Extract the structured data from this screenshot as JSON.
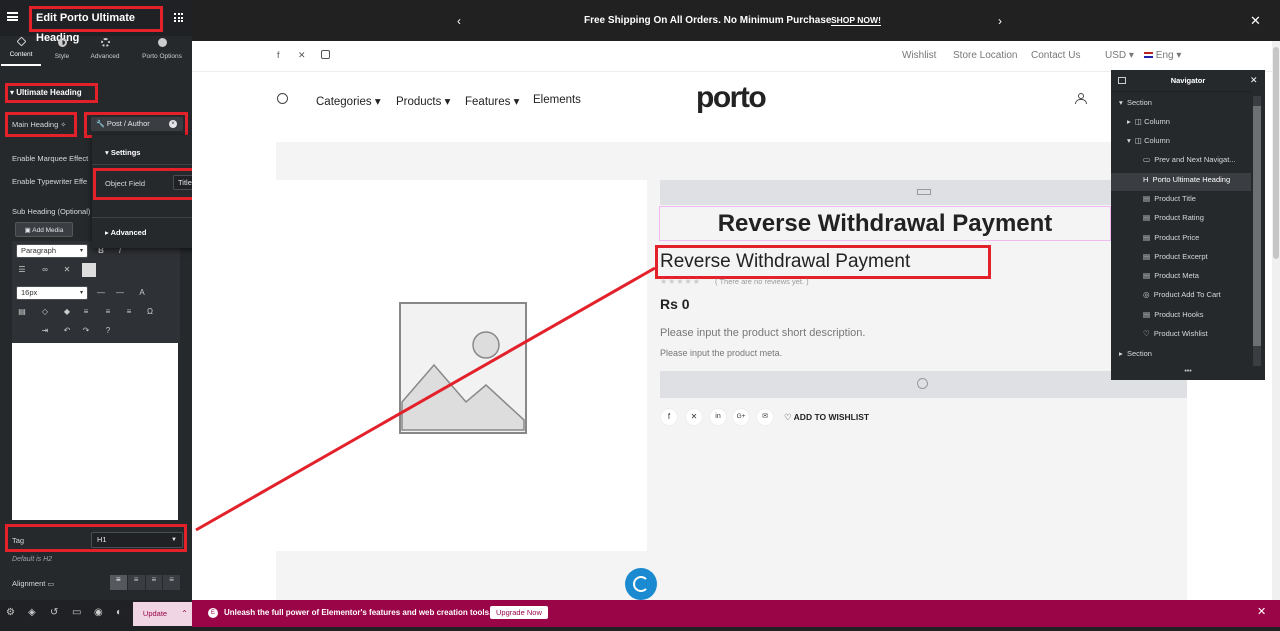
{
  "editor": {
    "title": "Edit Porto Ultimate Heading",
    "tabs": [
      {
        "label": "Content",
        "icon": "pencil-icon"
      },
      {
        "label": "Style",
        "icon": "contrast-icon"
      },
      {
        "label": "Advanced",
        "icon": "gear-icon"
      },
      {
        "label": "Porto Options",
        "icon": "porto-icon"
      }
    ],
    "section_title": "Ultimate Heading",
    "main_heading_label": "Main Heading",
    "dynamic_tag_chip": "Post / Author",
    "enable_marquee_label": "Enable Marquee Effect",
    "enable_typewriter_label": "Enable Typewriter Effe",
    "sub_heading_label": "Sub Heading (Optional)",
    "add_media_label": "Add Media",
    "paragraph_select": "Paragraph",
    "font_size_select": "16px",
    "tag_label": "Tag",
    "tag_value": "H1",
    "default_note": "Default is H2",
    "alignment_label": "Alignment"
  },
  "popover": {
    "settings_title": "Settings",
    "object_field_label": "Object Field",
    "object_field_value": "Title",
    "advanced_title": "Advanced"
  },
  "topbar": {
    "announcement": "Free Shipping On All Orders. No Minimum Purchase",
    "shop_now": "SHOP NOW!"
  },
  "site_header": {
    "links": [
      "Wishlist",
      "Store Location",
      "Contact Us"
    ],
    "currency": "USD",
    "language": "Eng",
    "menu": [
      "Categories",
      "Products",
      "Features",
      "Elements"
    ],
    "logo": "porto"
  },
  "product": {
    "heading_big": "Reverse Withdrawal Payment",
    "heading_small": "Reverse Withdrawal Payment",
    "reviews": "( There are no reviews yet. )",
    "price": "Rs 0",
    "short_description": "Please input the product short description.",
    "meta": "Please input the product meta.",
    "add_to_wishlist": "ADD TO WISHLIST"
  },
  "navigator": {
    "title": "Navigator",
    "items": [
      {
        "label": "Section",
        "level": 0
      },
      {
        "label": "Column",
        "level": 1
      },
      {
        "label": "Column",
        "level": 1
      },
      {
        "label": "Prev and Next Navigat...",
        "level": 2
      },
      {
        "label": "Porto Ultimate Heading",
        "level": 2
      },
      {
        "label": "Product Title",
        "level": 2
      },
      {
        "label": "Product Rating",
        "level": 2
      },
      {
        "label": "Product Price",
        "level": 2
      },
      {
        "label": "Product Excerpt",
        "level": 2
      },
      {
        "label": "Product Meta",
        "level": 2
      },
      {
        "label": "Product Add To Cart",
        "level": 2
      },
      {
        "label": "Product Hooks",
        "level": 2
      },
      {
        "label": "Product Wishlist",
        "level": 2
      },
      {
        "label": "Section",
        "level": 0
      }
    ]
  },
  "bottom": {
    "update_label": "Update",
    "promo_text": "Unleash the full power of Elementor's features and web creation tools.",
    "upgrade_label": "Upgrade Now"
  },
  "colors": {
    "accent_red": "#e2212b",
    "elementor_pink": "#9a0548",
    "panel_dark": "#26292c"
  }
}
